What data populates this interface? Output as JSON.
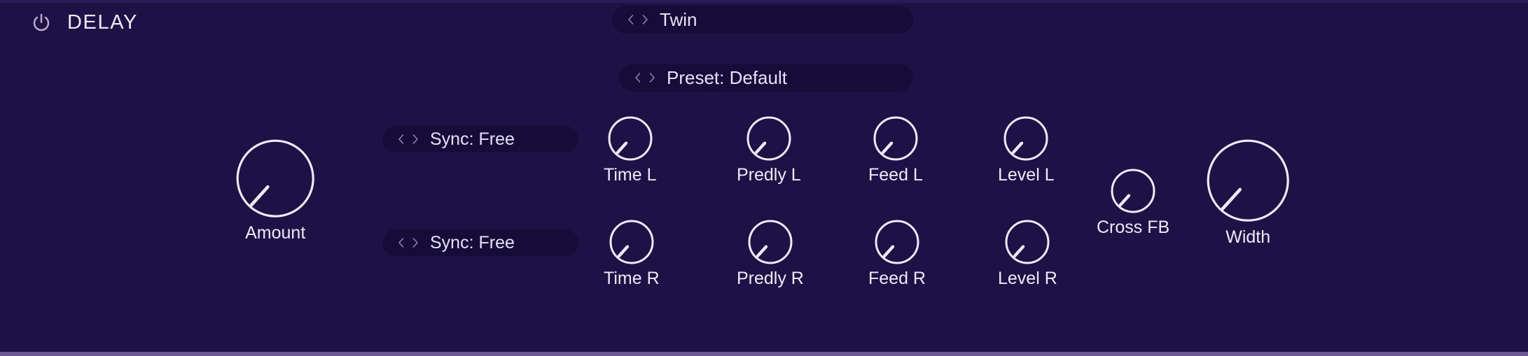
{
  "panel": {
    "title": "DELAY",
    "power_icon": "power-icon",
    "enabled": true,
    "background_color": "#1e1145",
    "accent_color": "#efeaf8",
    "rail_bottom_color": "#6b5a93"
  },
  "selectors": [
    {
      "name": "algorithm-selector",
      "value": "Twin",
      "prev_icon": "chevron-left-icon",
      "next_icon": "chevron-right-icon"
    },
    {
      "name": "preset-selector",
      "value": "Preset: Default",
      "prev_icon": "chevron-left-icon",
      "next_icon": "chevron-right-icon"
    },
    {
      "name": "sync-left-selector",
      "value": "Sync: Free",
      "prev_icon": "chevron-left-icon",
      "next_icon": "chevron-right-icon"
    },
    {
      "name": "sync-right-selector",
      "value": "Sync: Free",
      "prev_icon": "chevron-left-icon",
      "next_icon": "chevron-right-icon"
    }
  ],
  "knobs": {
    "amount": {
      "label": "Amount",
      "angle_deg": 222,
      "radius": 54
    },
    "time_l": {
      "label": "Time L",
      "angle_deg": 222,
      "radius": 30
    },
    "predly_l": {
      "label": "Predly L",
      "angle_deg": 222,
      "radius": 30
    },
    "feed_l": {
      "label": "Feed L",
      "angle_deg": 222,
      "radius": 30
    },
    "level_l": {
      "label": "Level L",
      "angle_deg": 222,
      "radius": 30
    },
    "time_r": {
      "label": "Time R",
      "angle_deg": 222,
      "radius": 30
    },
    "predly_r": {
      "label": "Predly R",
      "angle_deg": 222,
      "radius": 30
    },
    "feed_r": {
      "label": "Feed R",
      "angle_deg": 222,
      "radius": 30
    },
    "level_r": {
      "label": "Level R",
      "angle_deg": 222,
      "radius": 30
    },
    "cross_fb": {
      "label": "Cross FB",
      "angle_deg": 222,
      "radius": 30
    },
    "width": {
      "label": "Width",
      "angle_deg": 222,
      "radius": 57
    }
  }
}
